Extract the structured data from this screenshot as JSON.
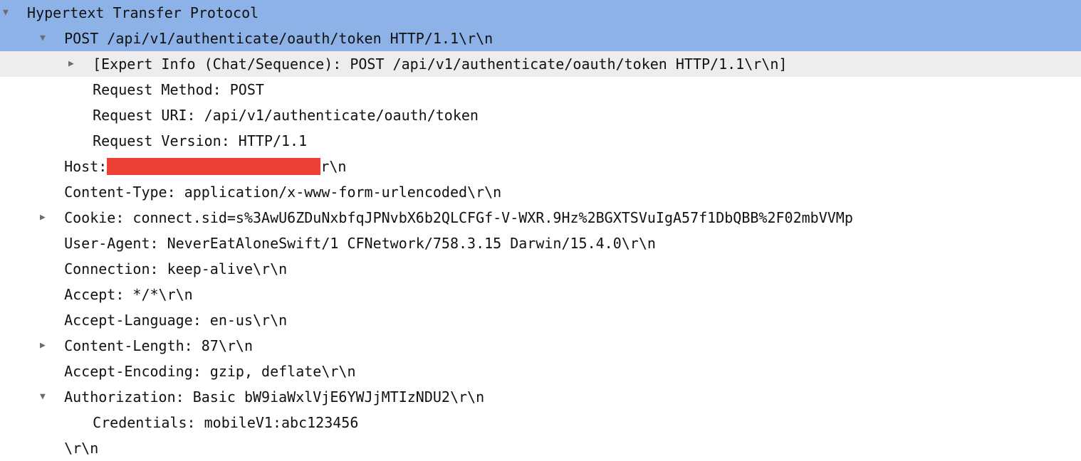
{
  "triangles": {
    "down": "▼",
    "right": "▶"
  },
  "lines": {
    "l1": {
      "tri": "down",
      "text": "Hypertext Transfer Protocol"
    },
    "l2": {
      "tri": "down",
      "text": "POST /api/v1/authenticate/oauth/token HTTP/1.1\\r\\n"
    },
    "l3": {
      "tri": "right",
      "text": "[Expert Info (Chat/Sequence): POST /api/v1/authenticate/oauth/token HTTP/1.1\\r\\n]"
    },
    "l4": {
      "tri": "",
      "text": "Request Method: POST"
    },
    "l5": {
      "tri": "",
      "text": "Request URI: /api/v1/authenticate/oauth/token"
    },
    "l6": {
      "tri": "",
      "text": "Request Version: HTTP/1.1"
    },
    "l7a": {
      "tri": "",
      "prefix": "Host:",
      "suffix": "r\\n"
    },
    "l8": {
      "tri": "",
      "text": "Content-Type: application/x-www-form-urlencoded\\r\\n"
    },
    "l9": {
      "tri": "right",
      "text": "Cookie: connect.sid=s%3AwU6ZDuNxbfqJPNvbX6b2QLCFGf-V-WXR.9Hz%2BGXTSVuIgA57f1DbQBB%2F02mbVVMp"
    },
    "l10": {
      "tri": "",
      "text": "User-Agent: NeverEatAloneSwift/1 CFNetwork/758.3.15 Darwin/15.4.0\\r\\n"
    },
    "l11": {
      "tri": "",
      "text": "Connection: keep-alive\\r\\n"
    },
    "l12": {
      "tri": "",
      "text": "Accept: */*\\r\\n"
    },
    "l13": {
      "tri": "",
      "text": "Accept-Language: en-us\\r\\n"
    },
    "l14": {
      "tri": "right",
      "text": "Content-Length: 87\\r\\n"
    },
    "l15": {
      "tri": "",
      "text": "Accept-Encoding: gzip, deflate\\r\\n"
    },
    "l16": {
      "tri": "down",
      "text": "Authorization: Basic bW9iaWxlVjE6YWJjMTIzNDU2\\r\\n"
    },
    "l17": {
      "tri": "",
      "text": "Credentials: mobileV1:abc123456"
    },
    "l18": {
      "tri": "",
      "text": "\\r\\n"
    }
  }
}
